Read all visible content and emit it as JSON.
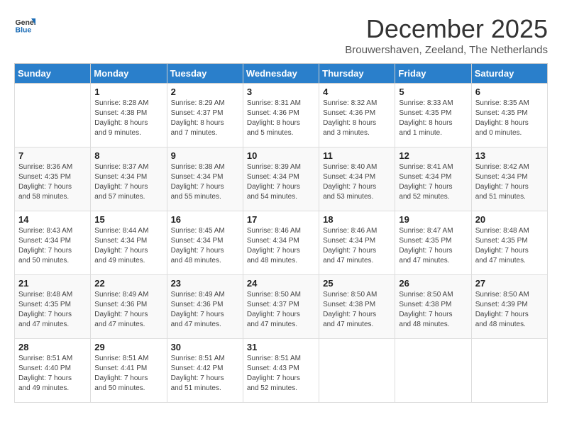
{
  "logo": {
    "line1": "General",
    "line2": "Blue"
  },
  "title": "December 2025",
  "subtitle": "Brouwershaven, Zeeland, The Netherlands",
  "weekdays": [
    "Sunday",
    "Monday",
    "Tuesday",
    "Wednesday",
    "Thursday",
    "Friday",
    "Saturday"
  ],
  "weeks": [
    [
      {
        "day": "",
        "info": ""
      },
      {
        "day": "1",
        "info": "Sunrise: 8:28 AM\nSunset: 4:38 PM\nDaylight: 8 hours\nand 9 minutes."
      },
      {
        "day": "2",
        "info": "Sunrise: 8:29 AM\nSunset: 4:37 PM\nDaylight: 8 hours\nand 7 minutes."
      },
      {
        "day": "3",
        "info": "Sunrise: 8:31 AM\nSunset: 4:36 PM\nDaylight: 8 hours\nand 5 minutes."
      },
      {
        "day": "4",
        "info": "Sunrise: 8:32 AM\nSunset: 4:36 PM\nDaylight: 8 hours\nand 3 minutes."
      },
      {
        "day": "5",
        "info": "Sunrise: 8:33 AM\nSunset: 4:35 PM\nDaylight: 8 hours\nand 1 minute."
      },
      {
        "day": "6",
        "info": "Sunrise: 8:35 AM\nSunset: 4:35 PM\nDaylight: 8 hours\nand 0 minutes."
      }
    ],
    [
      {
        "day": "7",
        "info": "Sunrise: 8:36 AM\nSunset: 4:35 PM\nDaylight: 7 hours\nand 58 minutes."
      },
      {
        "day": "8",
        "info": "Sunrise: 8:37 AM\nSunset: 4:34 PM\nDaylight: 7 hours\nand 57 minutes."
      },
      {
        "day": "9",
        "info": "Sunrise: 8:38 AM\nSunset: 4:34 PM\nDaylight: 7 hours\nand 55 minutes."
      },
      {
        "day": "10",
        "info": "Sunrise: 8:39 AM\nSunset: 4:34 PM\nDaylight: 7 hours\nand 54 minutes."
      },
      {
        "day": "11",
        "info": "Sunrise: 8:40 AM\nSunset: 4:34 PM\nDaylight: 7 hours\nand 53 minutes."
      },
      {
        "day": "12",
        "info": "Sunrise: 8:41 AM\nSunset: 4:34 PM\nDaylight: 7 hours\nand 52 minutes."
      },
      {
        "day": "13",
        "info": "Sunrise: 8:42 AM\nSunset: 4:34 PM\nDaylight: 7 hours\nand 51 minutes."
      }
    ],
    [
      {
        "day": "14",
        "info": "Sunrise: 8:43 AM\nSunset: 4:34 PM\nDaylight: 7 hours\nand 50 minutes."
      },
      {
        "day": "15",
        "info": "Sunrise: 8:44 AM\nSunset: 4:34 PM\nDaylight: 7 hours\nand 49 minutes."
      },
      {
        "day": "16",
        "info": "Sunrise: 8:45 AM\nSunset: 4:34 PM\nDaylight: 7 hours\nand 48 minutes."
      },
      {
        "day": "17",
        "info": "Sunrise: 8:46 AM\nSunset: 4:34 PM\nDaylight: 7 hours\nand 48 minutes."
      },
      {
        "day": "18",
        "info": "Sunrise: 8:46 AM\nSunset: 4:34 PM\nDaylight: 7 hours\nand 47 minutes."
      },
      {
        "day": "19",
        "info": "Sunrise: 8:47 AM\nSunset: 4:35 PM\nDaylight: 7 hours\nand 47 minutes."
      },
      {
        "day": "20",
        "info": "Sunrise: 8:48 AM\nSunset: 4:35 PM\nDaylight: 7 hours\nand 47 minutes."
      }
    ],
    [
      {
        "day": "21",
        "info": "Sunrise: 8:48 AM\nSunset: 4:35 PM\nDaylight: 7 hours\nand 47 minutes."
      },
      {
        "day": "22",
        "info": "Sunrise: 8:49 AM\nSunset: 4:36 PM\nDaylight: 7 hours\nand 47 minutes."
      },
      {
        "day": "23",
        "info": "Sunrise: 8:49 AM\nSunset: 4:36 PM\nDaylight: 7 hours\nand 47 minutes."
      },
      {
        "day": "24",
        "info": "Sunrise: 8:50 AM\nSunset: 4:37 PM\nDaylight: 7 hours\nand 47 minutes."
      },
      {
        "day": "25",
        "info": "Sunrise: 8:50 AM\nSunset: 4:38 PM\nDaylight: 7 hours\nand 47 minutes."
      },
      {
        "day": "26",
        "info": "Sunrise: 8:50 AM\nSunset: 4:38 PM\nDaylight: 7 hours\nand 48 minutes."
      },
      {
        "day": "27",
        "info": "Sunrise: 8:50 AM\nSunset: 4:39 PM\nDaylight: 7 hours\nand 48 minutes."
      }
    ],
    [
      {
        "day": "28",
        "info": "Sunrise: 8:51 AM\nSunset: 4:40 PM\nDaylight: 7 hours\nand 49 minutes."
      },
      {
        "day": "29",
        "info": "Sunrise: 8:51 AM\nSunset: 4:41 PM\nDaylight: 7 hours\nand 50 minutes."
      },
      {
        "day": "30",
        "info": "Sunrise: 8:51 AM\nSunset: 4:42 PM\nDaylight: 7 hours\nand 51 minutes."
      },
      {
        "day": "31",
        "info": "Sunrise: 8:51 AM\nSunset: 4:43 PM\nDaylight: 7 hours\nand 52 minutes."
      },
      {
        "day": "",
        "info": ""
      },
      {
        "day": "",
        "info": ""
      },
      {
        "day": "",
        "info": ""
      }
    ]
  ]
}
